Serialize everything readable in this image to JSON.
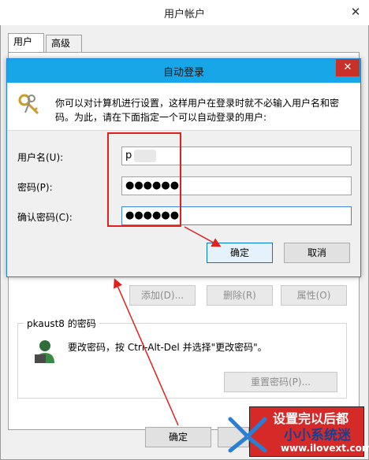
{
  "window": {
    "title": "用户帐户",
    "close": "✕"
  },
  "tabs": [
    {
      "label": "用户"
    },
    {
      "label": "高级"
    }
  ],
  "dialog": {
    "title": "自动登录",
    "close": "✕",
    "description": "你可以对计算机进行设置，这样用户在登录时就不必输入用户名和密码。为此，请在下面指定一个可以自动登录的用户:",
    "fields": {
      "username": {
        "label": "用户名(U):",
        "value": "p        8"
      },
      "password": {
        "label": "密码(P):",
        "value": "●●●●●●"
      },
      "confirm": {
        "label": "确认密码(C):",
        "value": "●●●●●●"
      }
    },
    "ok": "确定",
    "cancel": "取消"
  },
  "user_buttons": {
    "add": "添加(D)...",
    "remove": "删除(R)",
    "properties": "属性(O)"
  },
  "password_group": {
    "title": "pkaust8 的密码",
    "text": "要改密码，按 Ctrl-Alt-Del 并选择\"更改密码\"。",
    "reset": "重置密码(P)..."
  },
  "footer": {
    "ok": "确定"
  },
  "watermark": {
    "line1": "设置完以后都",
    "line2": "小小系统迷",
    "url": "www.ilovext.com"
  },
  "colors": {
    "dialog_title_bar": "#17a6e8",
    "close_button": "#c7312a",
    "highlight": "#e0211d"
  }
}
